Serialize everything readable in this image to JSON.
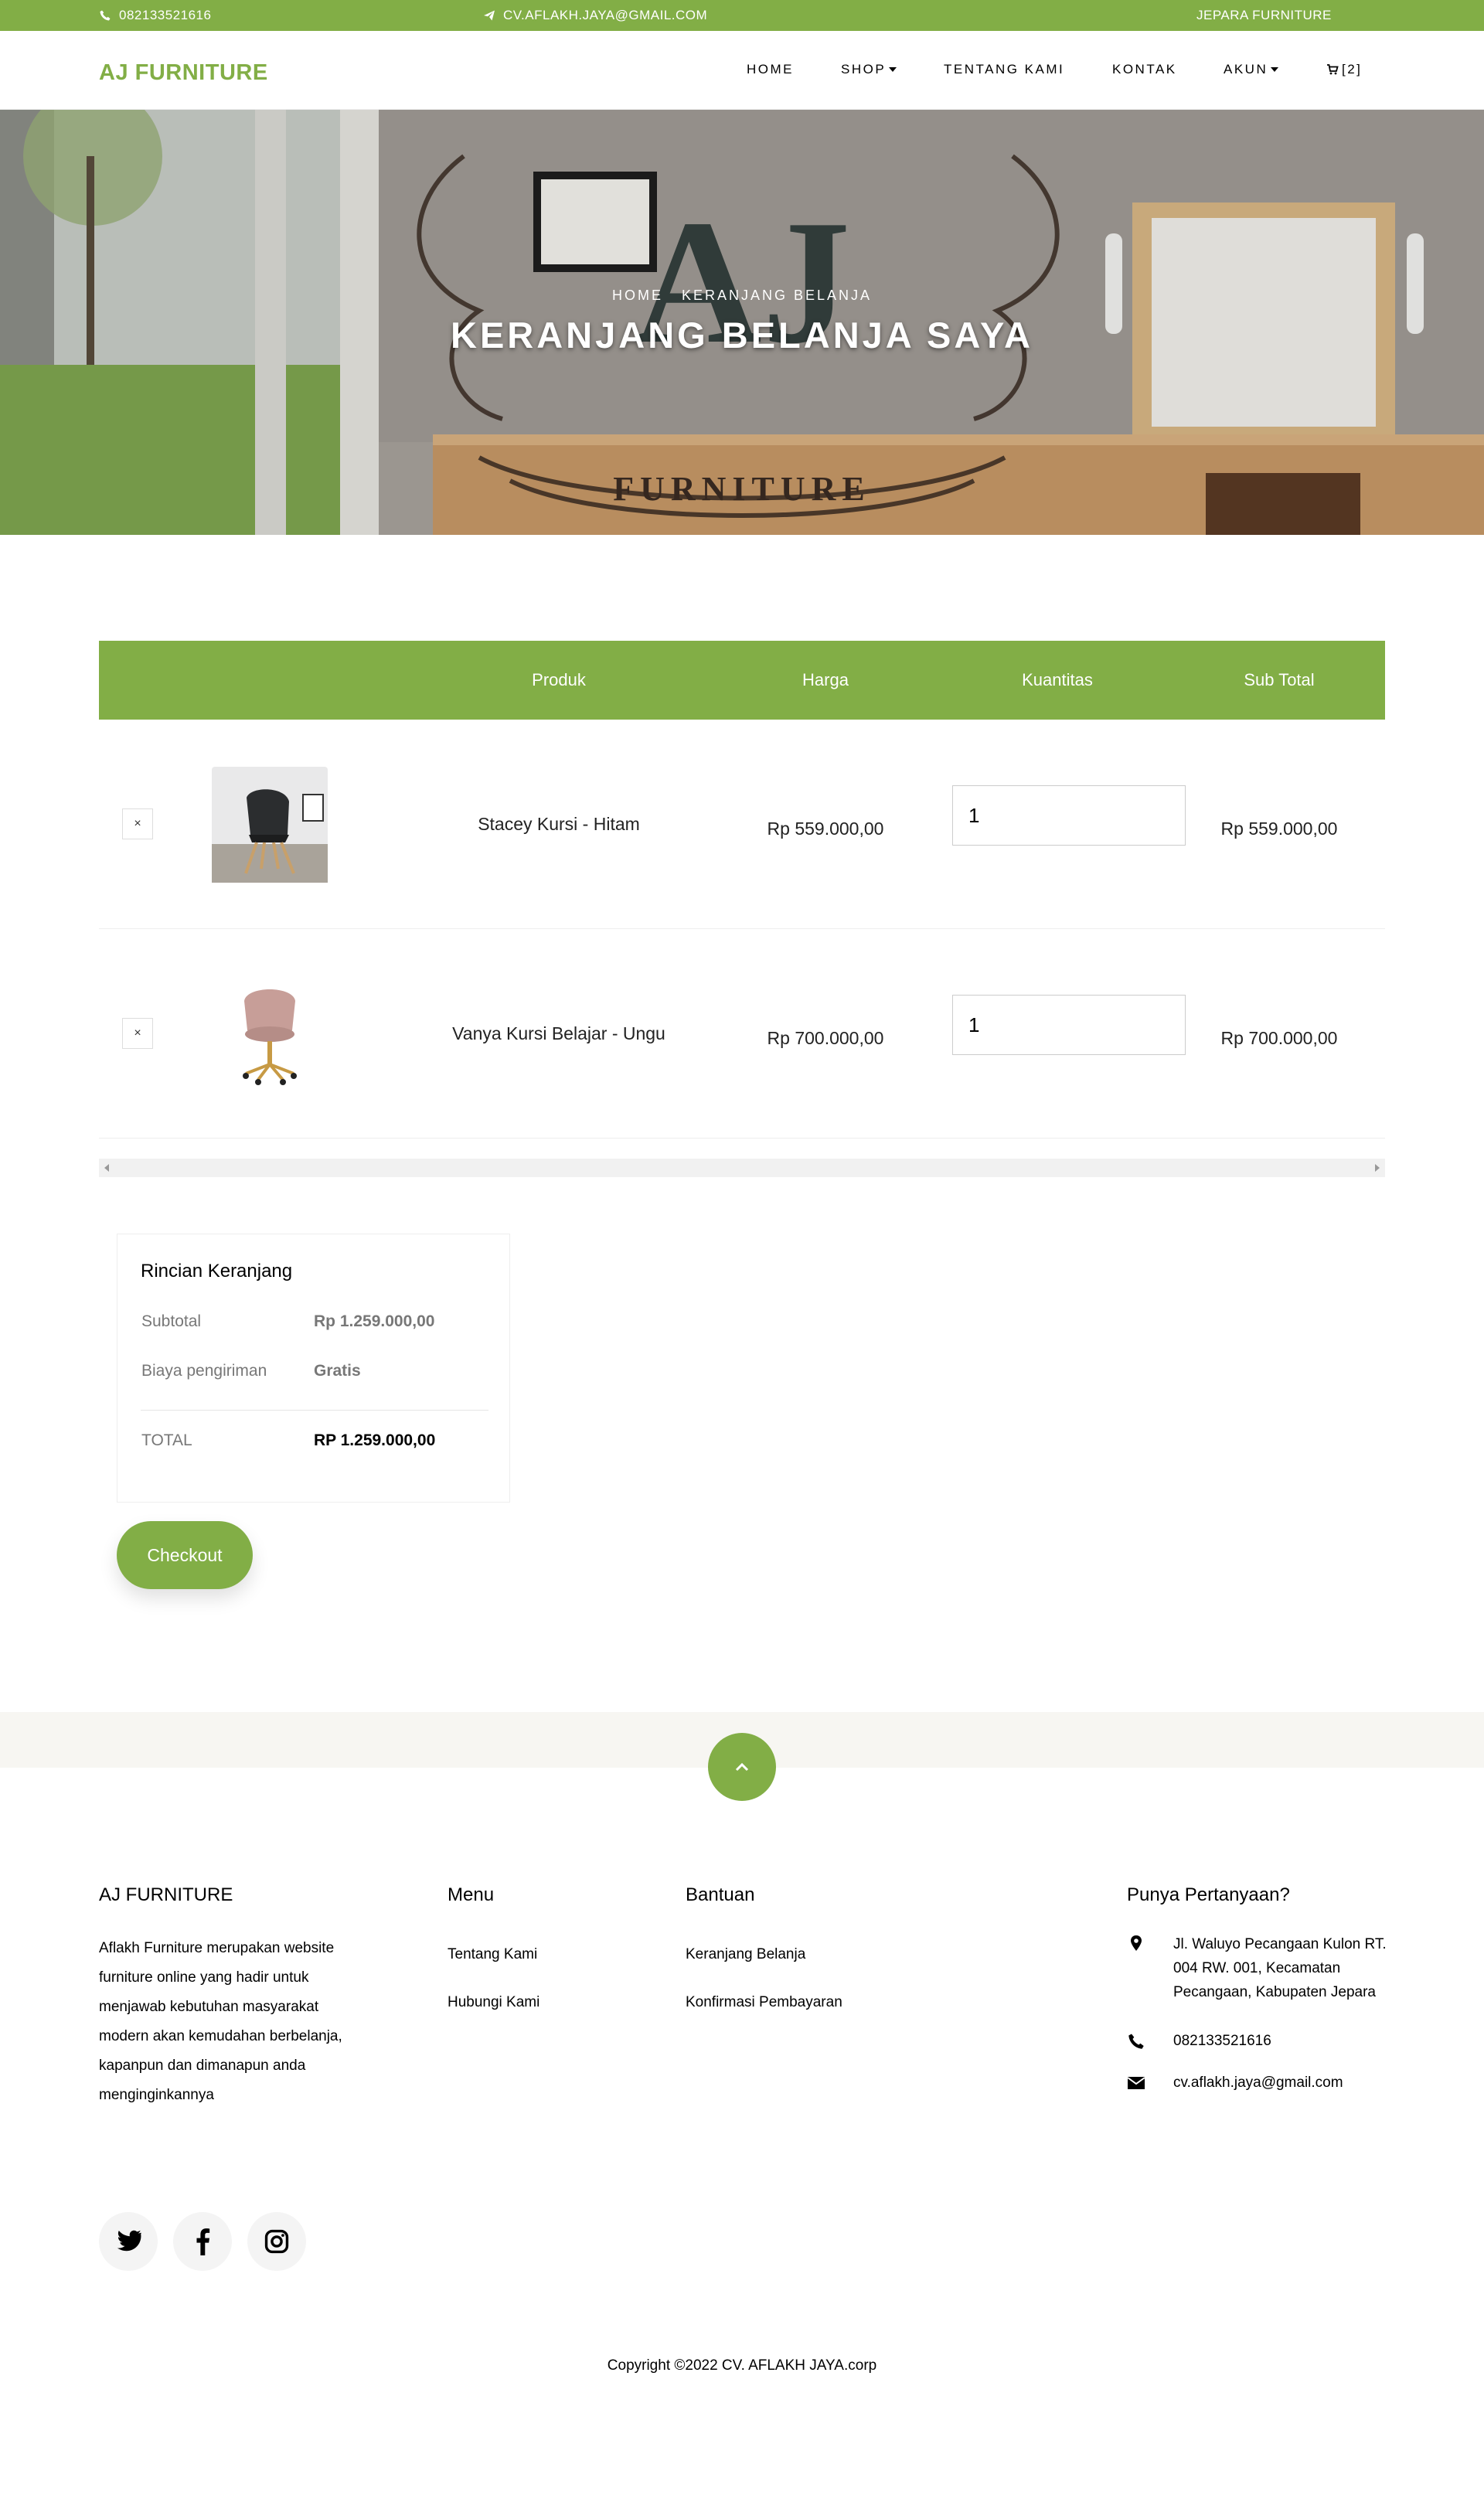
{
  "topbar": {
    "phone": "082133521616",
    "email": "CV.AFLAKH.JAYA@GMAIL.COM",
    "tagline": "JEPARA FURNITURE"
  },
  "nav": {
    "brand": "AJ FURNITURE",
    "items": [
      "HOME",
      "SHOP",
      "TENTANG KAMI",
      "KONTAK",
      "AKUN"
    ],
    "cart": "[2]"
  },
  "hero": {
    "breadcrumb_home": "HOME",
    "breadcrumb_current": "KERANJANG BELANJA",
    "title": "KERANJANG BELANJA SAYA",
    "logo_text": "FURNITURE"
  },
  "cart": {
    "headers": [
      "Produk",
      "Harga",
      "Kuantitas",
      "Sub Total"
    ],
    "remove_symbol": "×",
    "items": [
      {
        "name": "Stacey Kursi - Hitam",
        "price": "Rp 559.000,00",
        "qty": "1",
        "subtotal": "Rp 559.000,00"
      },
      {
        "name": "Vanya Kursi Belajar - Ungu",
        "price": "Rp 700.000,00",
        "qty": "1",
        "subtotal": "Rp 700.000,00"
      }
    ]
  },
  "totals": {
    "title": "Rincian Keranjang",
    "subtotal_label": "Subtotal",
    "subtotal_value": "Rp 1.259.000,00",
    "shipping_label": "Biaya pengiriman",
    "shipping_value": "Gratis",
    "total_label": "TOTAL",
    "total_value": "RP 1.259.000,00",
    "checkout": "Checkout"
  },
  "footer": {
    "about_title": "AJ FURNITURE",
    "about_text": "Aflakh Furniture merupakan website furniture online yang hadir untuk menjawab kebutuhan masyarakat modern akan kemudahan berbelanja, kapanpun dan dimanapun anda menginginkannya",
    "menu_title": "Menu",
    "menu_links": [
      "Tentang Kami",
      "Hubungi Kami"
    ],
    "help_title": "Bantuan",
    "help_links": [
      "Keranjang Belanja",
      "Konfirmasi Pembayaran"
    ],
    "contact_title": "Punya Pertanyaan?",
    "address": "Jl. Waluyo Pecangaan Kulon RT. 004 RW. 001, Kecamatan Pecangaan, Kabupaten Jepara",
    "phone": "082133521616",
    "email": "cv.aflakh.jaya@gmail.com",
    "copyright": "Copyright ©2022 CV. AFLAKH JAYA.corp"
  },
  "colors": {
    "accent": "#82ae46",
    "band": "#f7f6f2"
  }
}
